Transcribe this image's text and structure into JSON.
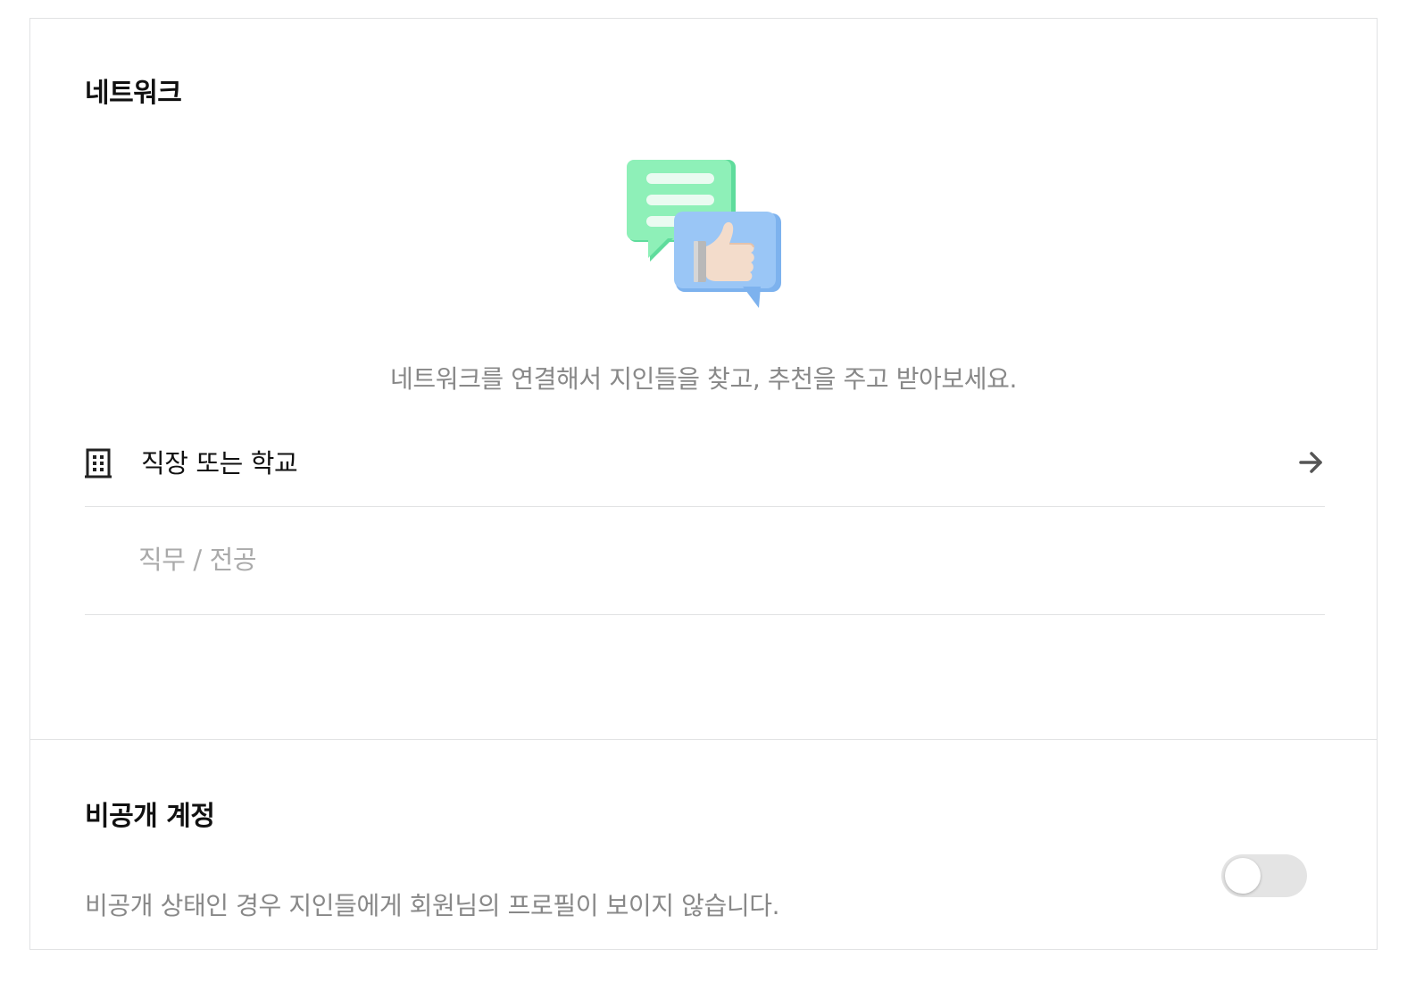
{
  "network": {
    "title": "네트워크",
    "description": "네트워크를 연결해서 지인들을 찾고, 추천을 주고 받아보세요.",
    "workplace_label": "직장 또는 학교",
    "job_placeholder": "직무 / 전공",
    "job_value": ""
  },
  "private_account": {
    "title": "비공개 계정",
    "description": "비공개 상태인 경우 지인들에게 회원님의 프로필이 보이지 않습니다.",
    "toggle_on": false
  },
  "icons": {
    "illustration": "chat-bubbles-thumbs-up-illustration",
    "workplace": "building-icon",
    "navigate": "arrow-right-icon"
  },
  "colors": {
    "green_bubble": "#8ef0b8",
    "blue_bubble": "#9ac6f6",
    "border": "#e1e2e3",
    "muted_text": "#888888"
  }
}
